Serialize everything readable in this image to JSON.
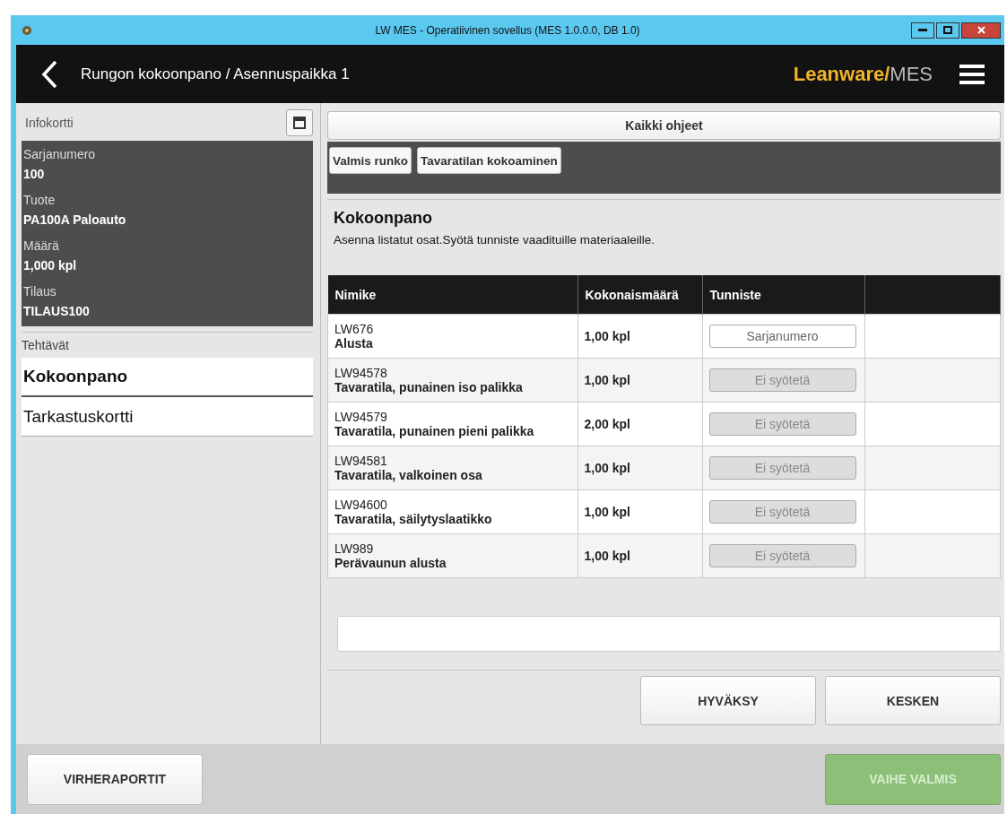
{
  "window": {
    "title": "LW MES - Operatiivinen sovellus (MES 1.0.0.0, DB 1.0)"
  },
  "header": {
    "title": "Rungon kokoonpano / Asennuspaikka 1",
    "brand": "Leanware/",
    "brand_suffix": "MES"
  },
  "infocard": {
    "title": "Infokortti",
    "fields": [
      {
        "label": "Sarjanumero",
        "value": "100"
      },
      {
        "label": "Tuote",
        "value": "PA100A Paloauto"
      },
      {
        "label": "Määrä",
        "value": "1,000 kpl"
      },
      {
        "label": "Tilaus",
        "value": "TILAUS100"
      }
    ]
  },
  "tasks": {
    "title": "Tehtävät",
    "items": [
      {
        "label": "Kokoonpano",
        "selected": true
      },
      {
        "label": "Tarkastuskortti",
        "selected": false
      }
    ]
  },
  "all_instructions": "Kaikki ohjeet",
  "instruction_tabs": [
    "Valmis runko",
    "Tavaratilan kokoaminen"
  ],
  "step": {
    "title": "Kokoonpano",
    "description": "Asenna listatut osat.Syötä tunniste vaadituille materiaaleille."
  },
  "table": {
    "columns": [
      "Nimike",
      "Kokonaismäärä",
      "Tunniste"
    ],
    "rows": [
      {
        "code": "LW676",
        "name": "Alusta",
        "quantity": "1,00 kpl",
        "identifier": {
          "placeholder": "Sarjanumero",
          "disabled": false
        }
      },
      {
        "code": "LW94578",
        "name": "Tavaratila, punainen iso palikka",
        "quantity": "1,00 kpl",
        "identifier": {
          "placeholder": "Ei syötetä",
          "disabled": true
        }
      },
      {
        "code": "LW94579",
        "name": "Tavaratila, punainen pieni palikka",
        "quantity": "2,00 kpl",
        "identifier": {
          "placeholder": "Ei syötetä",
          "disabled": true
        }
      },
      {
        "code": "LW94581",
        "name": "Tavaratila, valkoinen osa",
        "quantity": "1,00 kpl",
        "identifier": {
          "placeholder": "Ei syötetä",
          "disabled": true
        }
      },
      {
        "code": "LW94600",
        "name": "Tavaratila, säilytyslaatikko",
        "quantity": "1,00 kpl",
        "identifier": {
          "placeholder": "Ei syötetä",
          "disabled": true
        }
      },
      {
        "code": "LW989",
        "name": "Perävaunun alusta",
        "quantity": "1,00 kpl",
        "identifier": {
          "placeholder": "Ei syötetä",
          "disabled": true
        }
      }
    ]
  },
  "actions": [
    {
      "label": "HYVÄKSY"
    },
    {
      "label": "KESKEN"
    }
  ],
  "footer": {
    "left": {
      "label": "VIRHERAPORTIT",
      "disabled": false
    },
    "right": {
      "label": "VAIHE VALMIS",
      "disabled": true
    }
  }
}
